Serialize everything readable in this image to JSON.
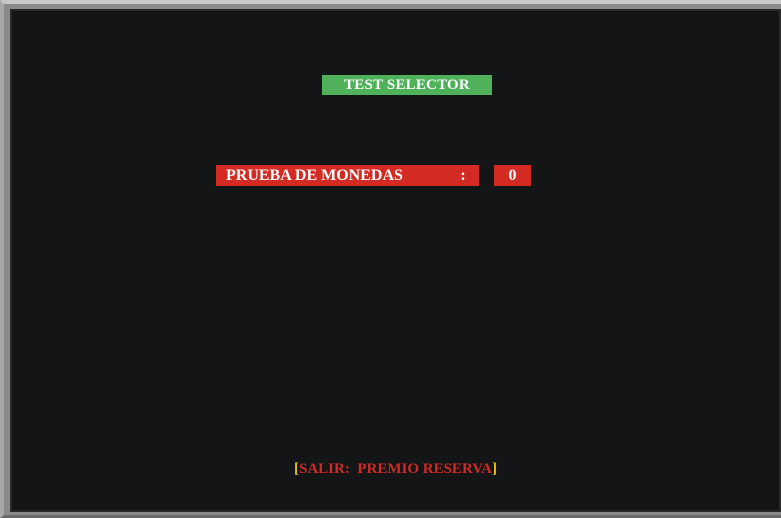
{
  "title": "TEST SELECTOR",
  "test_row": {
    "label": "PRUEBA DE MONEDAS",
    "separator": ":",
    "value": "0"
  },
  "footer": {
    "open_bracket": "[",
    "text": "SALIR:  PREMIO RESERVA",
    "close_bracket": "]"
  },
  "colors": {
    "background": "#141517",
    "title_bg": "#4fb25a",
    "row_bg": "#d32a24",
    "bracket": "#e8c21a",
    "footer_text": "#d32a24"
  }
}
